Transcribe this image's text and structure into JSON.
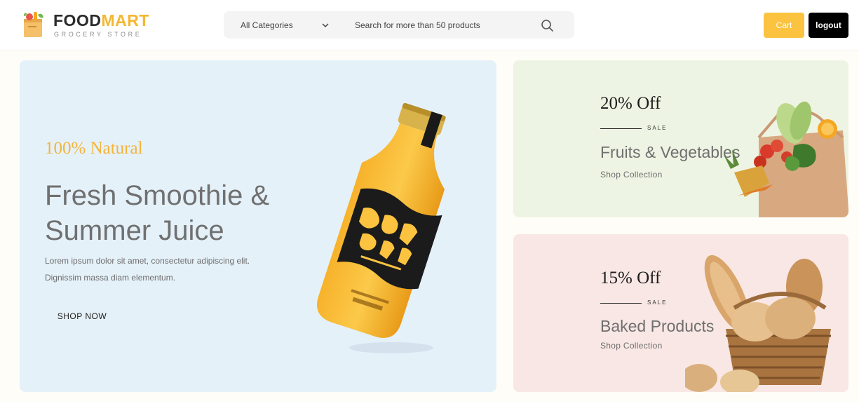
{
  "brand": {
    "name_part1": "FOOD",
    "name_part2": "MART",
    "tagline": "GROCERY STORE"
  },
  "search": {
    "category_selected": "All Categories",
    "placeholder": "Search for more than 50 products"
  },
  "header_actions": {
    "cart_label": "Cart",
    "logout_label": "logout"
  },
  "main_banner": {
    "eyebrow": "100% Natural",
    "title": "Fresh Smoothie & Summer Juice",
    "description": "Lorem ipsum dolor sit amet, consectetur adipiscing elit. Dignissim massa diam elementum.",
    "cta_label": "SHOP NOW"
  },
  "promos": [
    {
      "discount": "20% Off",
      "sale_label": "SALE",
      "name": "Fruits & Vegetables",
      "link_label": "Shop Collection"
    },
    {
      "discount": "15% Off",
      "sale_label": "SALE",
      "name": "Baked Products",
      "link_label": "Shop Collection"
    }
  ],
  "colors": {
    "brand_accent": "#f5b731",
    "cart_button": "#fbc33f",
    "logout_button": "#000000",
    "main_banner_bg": "#e5f1f9",
    "promo_green_bg": "#eef4e3",
    "promo_pink_bg": "#f8e7e4"
  },
  "icons": {
    "logo": "grocery-bag-icon",
    "category_toggle": "chevron-down-icon",
    "search": "search-icon"
  }
}
